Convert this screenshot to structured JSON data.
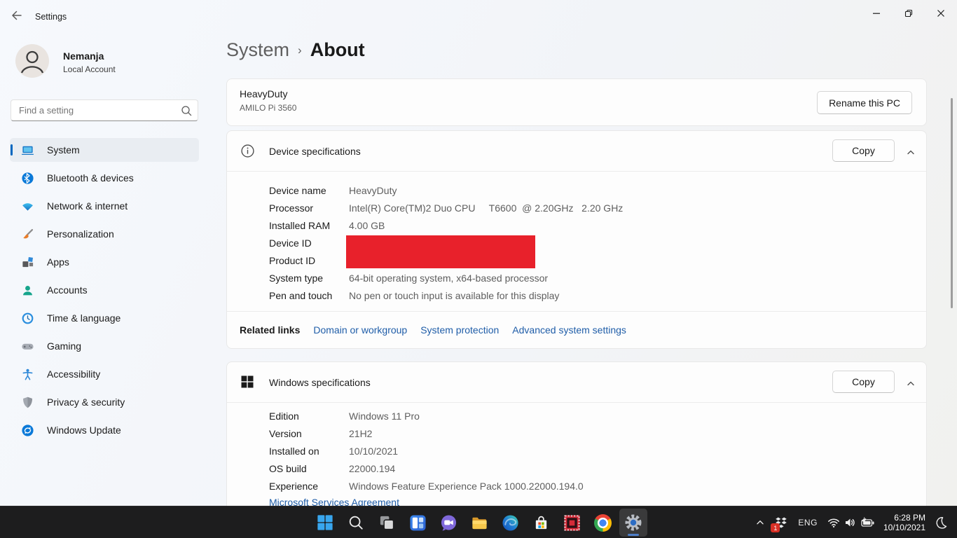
{
  "colors": {
    "accent": "#0067c0",
    "link": "#1f5da8",
    "redaction": "#e8212b",
    "taskbar_bg": "#1d1d1e"
  },
  "titlebar": {
    "title": "Settings"
  },
  "sidebar": {
    "user": {
      "name": "Nemanja",
      "account_type": "Local Account"
    },
    "search": {
      "placeholder": "Find a setting"
    },
    "items": [
      {
        "label": "System",
        "active": true
      },
      {
        "label": "Bluetooth & devices"
      },
      {
        "label": "Network & internet"
      },
      {
        "label": "Personalization"
      },
      {
        "label": "Apps"
      },
      {
        "label": "Accounts"
      },
      {
        "label": "Time & language"
      },
      {
        "label": "Gaming"
      },
      {
        "label": "Accessibility"
      },
      {
        "label": "Privacy & security"
      },
      {
        "label": "Windows Update"
      }
    ]
  },
  "breadcrumb": {
    "parent": "System",
    "separator": "›",
    "current": "About"
  },
  "device_card": {
    "device_name": "HeavyDuty",
    "device_model": "AMILO Pi 3560",
    "rename_button": "Rename this PC"
  },
  "device_specs": {
    "title": "Device specifications",
    "copy_button": "Copy",
    "rows": [
      {
        "label": "Device name",
        "value": "HeavyDuty"
      },
      {
        "label": "Processor",
        "value": "Intel(R) Core(TM)2 Duo CPU     T6600  @ 2.20GHz   2.20 GHz"
      },
      {
        "label": "Installed RAM",
        "value": "4.00 GB"
      },
      {
        "label": "Device ID",
        "value": "",
        "redacted": true
      },
      {
        "label": "Product ID",
        "value": "",
        "redacted": true
      },
      {
        "label": "System type",
        "value": "64-bit operating system, x64-based processor"
      },
      {
        "label": "Pen and touch",
        "value": "No pen or touch input is available for this display"
      }
    ],
    "related_links": {
      "title": "Related links",
      "links": [
        {
          "label": "Domain or workgroup"
        },
        {
          "label": "System protection"
        },
        {
          "label": "Advanced system settings"
        }
      ]
    }
  },
  "windows_specs": {
    "title": "Windows specifications",
    "copy_button": "Copy",
    "rows": [
      {
        "label": "Edition",
        "value": "Windows 11 Pro"
      },
      {
        "label": "Version",
        "value": "21H2"
      },
      {
        "label": "Installed on",
        "value": "10/10/2021"
      },
      {
        "label": "OS build",
        "value": "22000.194"
      },
      {
        "label": "Experience",
        "value": "Windows Feature Experience Pack 1000.22000.194.0"
      }
    ],
    "footer_link": "Microsoft Services Agreement"
  },
  "taskbar": {
    "apps": [
      "start",
      "search",
      "task-view",
      "widgets",
      "chat",
      "file-explorer",
      "edge",
      "store",
      "capture-app",
      "chrome",
      "settings"
    ],
    "active_app": "settings",
    "tray": {
      "language": "ENG",
      "notification_badge": "1",
      "time": "6:28 PM",
      "date": "10/10/2021"
    }
  }
}
